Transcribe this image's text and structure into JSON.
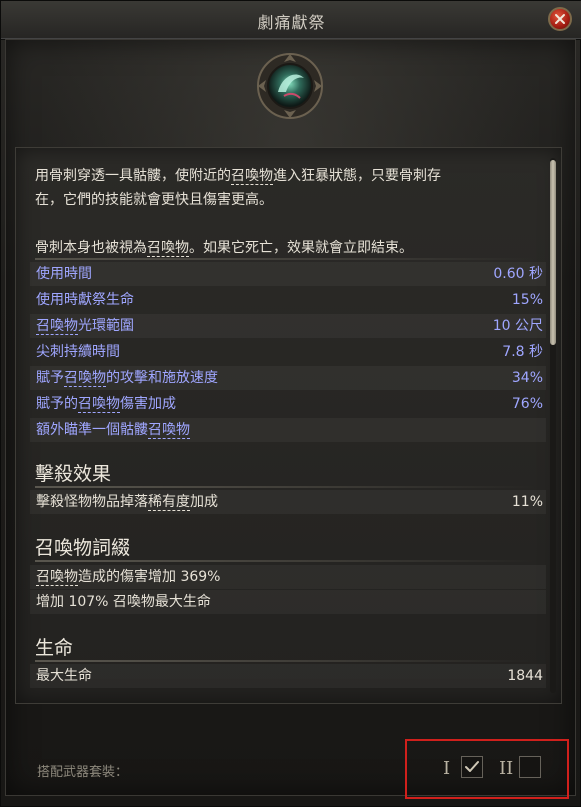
{
  "window": {
    "title": "劇痛獻祭"
  },
  "skill": {
    "icon": "bone-spirit-skill-icon"
  },
  "description": {
    "line1_a": "用骨刺穿透一具骷髏，使附近的",
    "line1_u": "召喚物",
    "line1_b": "進入狂暴狀態，只要骨刺存",
    "line2": "在，它們的技能就會更快且傷害更高。",
    "line3_a": "骨刺本身也被視為",
    "line3_u": "召喚物",
    "line3_b": "。如果它死亡，效果就會立即結束。"
  },
  "stats": [
    {
      "label": "使用時間",
      "value": "0.60 秒"
    },
    {
      "label": "使用時獻祭生命",
      "value": "15%"
    },
    {
      "label_u": "召喚物",
      "label": "光環範圍",
      "value": "10 公尺"
    },
    {
      "label": "尖刺持續時間",
      "value": "7.8 秒"
    },
    {
      "label_a": "賦予",
      "label_u": "召喚物",
      "label": "的攻擊和施放速度",
      "value": "34%"
    },
    {
      "label_a": "賦予的",
      "label_u": "召喚物",
      "label": "傷害加成",
      "value": "76%"
    },
    {
      "label_a": "額外瞄準一個骷髏",
      "label_u": "召喚物",
      "value": ""
    }
  ],
  "kill_effect": {
    "heading": "擊殺效果",
    "label_a": "擊殺怪物物品掉落",
    "label_u": "稀有度",
    "label_b": "加成",
    "value": "11%"
  },
  "minion_affixes": {
    "heading": "召喚物詞綴",
    "row1_u": "召喚物",
    "row1": "造成的傷害增加 369%",
    "row2": "增加 107% 召喚物最大生命"
  },
  "life": {
    "heading": "生命",
    "label": "最大生命",
    "value": "1844"
  },
  "weapon_sets": {
    "label": "搭配武器套裝：",
    "set1": "I",
    "set2": "II",
    "set1_checked": true,
    "set2_checked": false
  },
  "colors": {
    "stat_blue": "#9fa6ff",
    "highlight_box": "#d0201c",
    "close_red": "#a31d12"
  }
}
